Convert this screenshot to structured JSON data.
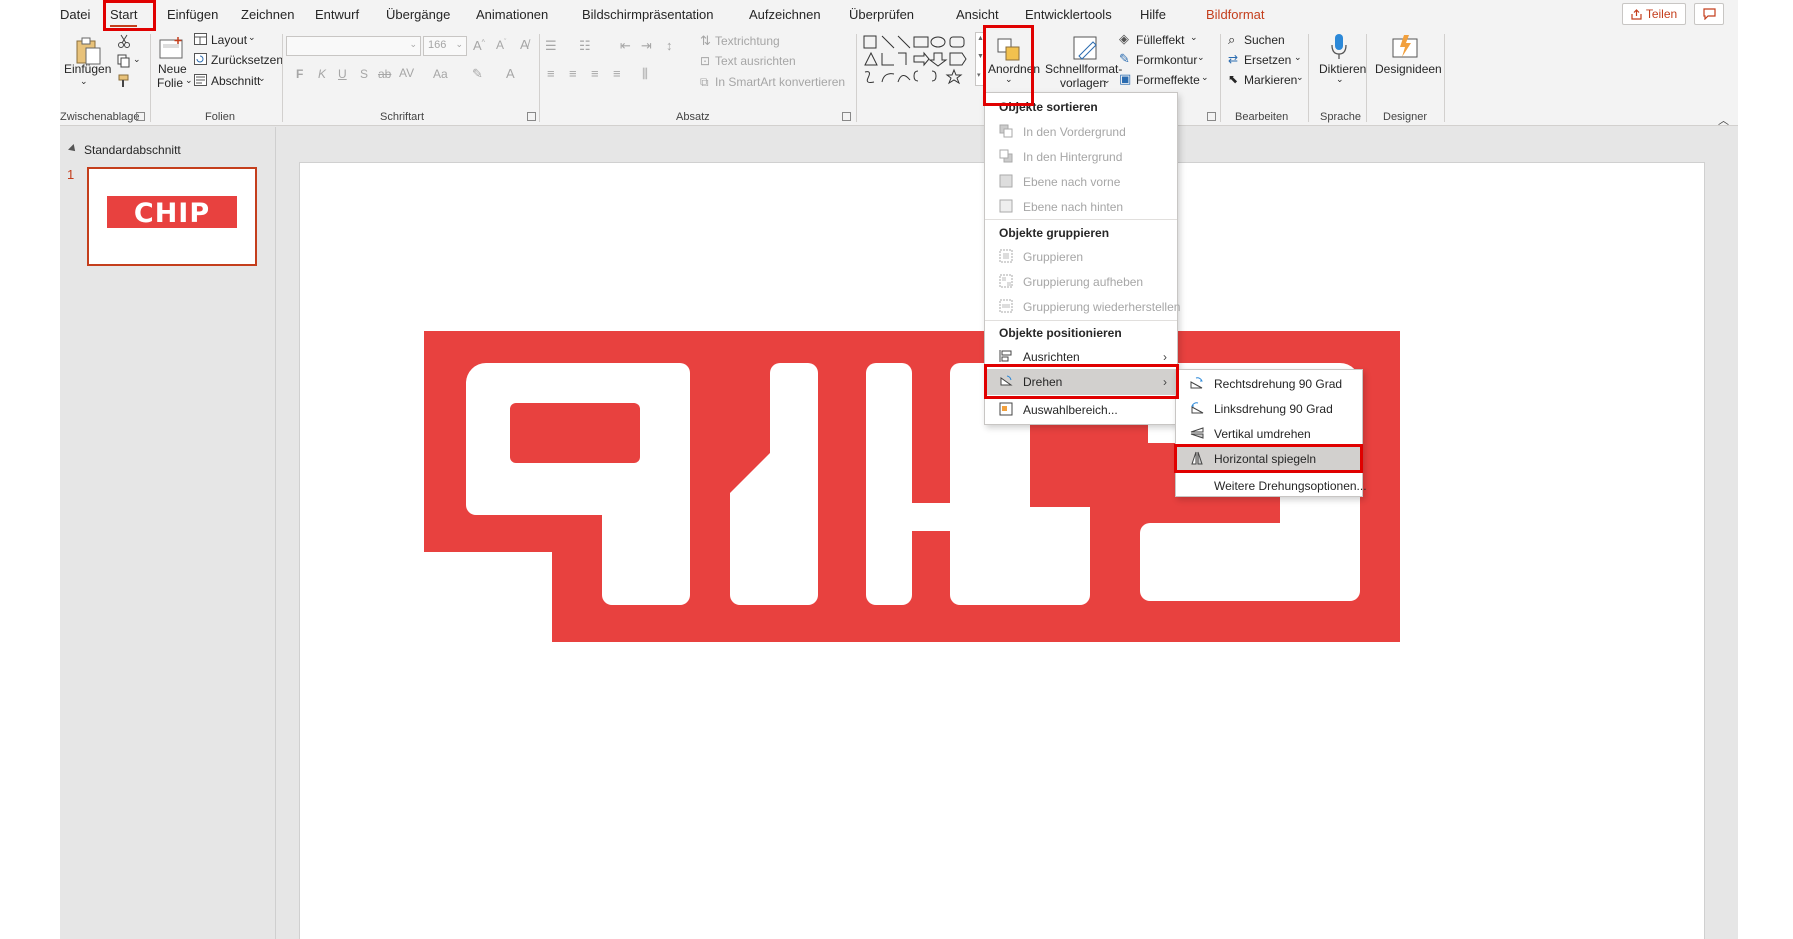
{
  "tabs": [
    "Datei",
    "Start",
    "Einfügen",
    "Zeichnen",
    "Entwurf",
    "Übergänge",
    "Animationen",
    "Bildschirmpräsentation",
    "Aufzeichnen",
    "Überprüfen",
    "Ansicht",
    "Entwicklertools",
    "Hilfe",
    "Bildformat"
  ],
  "share_label": "Teilen",
  "clipboard": {
    "paste": "Einfügen",
    "group": "Zwischenablage"
  },
  "slides_group": {
    "new_slide_1": "Neue",
    "new_slide_2": "Folie",
    "layout": "Layout",
    "reset": "Zurücksetzen",
    "section": "Abschnitt",
    "group": "Folien"
  },
  "font_group": {
    "size": "166",
    "group": "Schriftart",
    "bold": "F",
    "italic": "K",
    "underline": "U",
    "shadow": "S",
    "strike": "ab",
    "spacing": "AV",
    "case": "Aa"
  },
  "paragraph_group": {
    "text_direction": "Textrichtung",
    "align_text": "Text ausrichten",
    "smartart": "In SmartArt konvertieren",
    "group": "Absatz"
  },
  "drawing_group": {
    "arrange": "Anordnen",
    "quick_styles_1": "Schnellformat-",
    "quick_styles_2": "vorlagen",
    "fill": "Fülleffekt",
    "outline": "Formkontur",
    "effects": "Formeffekte"
  },
  "editing_group": {
    "find": "Suchen",
    "replace": "Ersetzen",
    "select": "Markieren",
    "group": "Bearbeiten"
  },
  "voice_group": {
    "dictate": "Diktieren",
    "group": "Sprache"
  },
  "designer_group": {
    "ideas": "Designideen",
    "group": "Designer"
  },
  "left_panel": {
    "section": "Standardabschnitt",
    "slide_number": "1",
    "thumb_logo": "CHIP"
  },
  "arrange_menu": {
    "h_sort": "Objekte sortieren",
    "bring_front": "In den Vordergrund",
    "send_back": "In den Hintergrund",
    "forward": "Ebene nach vorne",
    "backward": "Ebene nach hinten",
    "h_group": "Objekte gruppieren",
    "group": "Gruppieren",
    "ungroup": "Gruppierung aufheben",
    "regroup": "Gruppierung wiederherstellen",
    "h_position": "Objekte positionieren",
    "align": "Ausrichten",
    "rotate": "Drehen",
    "selection_pane": "Auswahlbereich..."
  },
  "rotate_menu": {
    "right90": "Rechtsdrehung 90 Grad",
    "left90": "Linksdrehung 90 Grad",
    "flip_v": "Vertikal umdrehen",
    "flip_h": "Horizontal spiegeln",
    "more": "Weitere Drehungsoptionen..."
  },
  "colors": {
    "accent": "#c43e1c",
    "logo_red": "#e8413f",
    "annotation": "#e00000"
  }
}
